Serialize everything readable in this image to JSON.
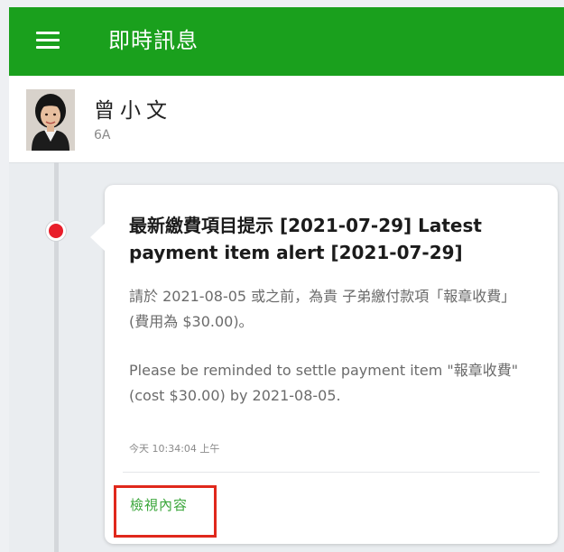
{
  "appbar": {
    "title": "即時訊息",
    "menu_icon": "hamburger-menu-icon",
    "color": "#1aa01d"
  },
  "profile": {
    "name": "曾小文",
    "class": "6A",
    "avatar_icon": "student-avatar"
  },
  "message": {
    "title": "最新繳費項目提示 [2021-07-29] Latest payment item alert [2021-07-29]",
    "body_zh": "請於 2021-08-05 或之前，為貴 子弟繳付款項「報章收費」(費用為 $30.00)。",
    "body_en": "Please be reminded to settle payment item \"報章收費\" (cost $30.00) by 2021-08-05.",
    "timestamp": "今天 10:34:04 上午",
    "view_link": "檢視內容",
    "unread_dot_color": "#e81e2a",
    "link_color": "#3aa63a"
  },
  "highlight_color": "#e0281c"
}
